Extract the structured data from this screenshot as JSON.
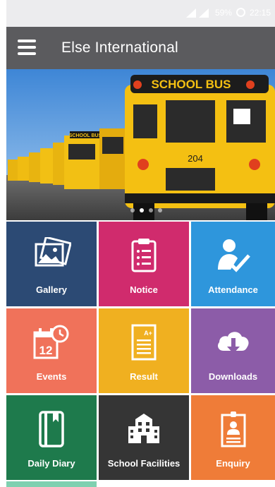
{
  "status": {
    "battery": "59%",
    "time": "22:15"
  },
  "app": {
    "title": "Else International"
  },
  "banner": {
    "bus_sign": "SCHOOL BUS",
    "bus_number": "204",
    "far_bus_sign": "SCHOOL BUS",
    "carousel_dots": 4,
    "active_dot": 1
  },
  "tiles": [
    {
      "label": "Gallery",
      "color": "#2c4a74",
      "icon": "gallery-icon"
    },
    {
      "label": "Notice",
      "color": "#d02b6d",
      "icon": "notice-icon"
    },
    {
      "label": "Attendance",
      "color": "#2e96dc",
      "icon": "attendance-icon"
    },
    {
      "label": "Events",
      "color": "#f0725a",
      "icon": "events-icon"
    },
    {
      "label": "Result",
      "color": "#f0b020",
      "icon": "result-icon"
    },
    {
      "label": "Downloads",
      "color": "#8c5ca8",
      "icon": "downloads-icon"
    },
    {
      "label": "Daily Diary",
      "color": "#1e7a4c",
      "icon": "daily-diary-icon"
    },
    {
      "label": "School Facilities",
      "color": "#353535",
      "icon": "school-facilities-icon"
    },
    {
      "label": "Enquiry",
      "color": "#ef7c38",
      "icon": "enquiry-icon"
    }
  ],
  "events_icon_text": "12",
  "result_icon_text": "A+"
}
